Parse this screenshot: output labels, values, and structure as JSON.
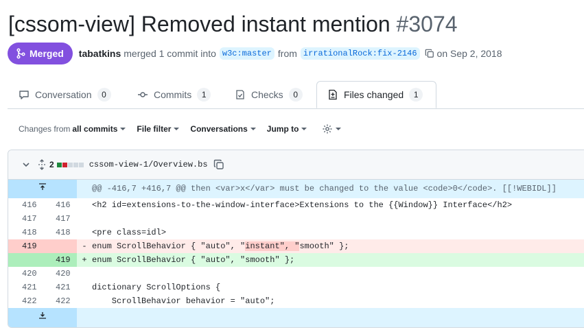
{
  "pr": {
    "title": "[cssom-view] Removed instant mention",
    "number": "#3074",
    "state": "Merged",
    "author": "tabatkins",
    "merged_text": "merged 1 commit into",
    "base_branch": "w3c:master",
    "from_text": "from",
    "head_branch": "irrationalRock:fix-2146",
    "date_text": "on Sep 2, 2018"
  },
  "tabs": [
    {
      "label": "Conversation",
      "count": "0",
      "icon": "comment-icon"
    },
    {
      "label": "Commits",
      "count": "1",
      "icon": "commit-icon"
    },
    {
      "label": "Checks",
      "count": "0",
      "icon": "checklist-icon"
    },
    {
      "label": "Files changed",
      "count": "1",
      "icon": "file-diff-icon"
    }
  ],
  "toolbar": {
    "changes_from_prefix": "Changes from",
    "changes_from_value": "all commits",
    "file_filter": "File filter",
    "conversations": "Conversations",
    "jump_to": "Jump to"
  },
  "file": {
    "change_count": "2",
    "filename": "cssom-view-1/Overview.bs",
    "diffstat": [
      "added",
      "deleted",
      "neutral",
      "neutral",
      "neutral"
    ],
    "colors": {
      "added": "#1f883d",
      "deleted": "#cf222e",
      "neutral": "#d1d9e0"
    }
  },
  "diff": {
    "hunk_header": "@@ -416,7 +416,7 @@ then <var>x</var> must be changed to the value <code>0</code>. [[!WEBIDL]]",
    "lines": [
      {
        "old": "416",
        "new": "416",
        "sign": "",
        "text": "<h2 id=extensions-to-the-window-interface>Extensions to the {{Window}} Interface</h2>"
      },
      {
        "old": "417",
        "new": "417",
        "sign": "",
        "text": ""
      },
      {
        "old": "418",
        "new": "418",
        "sign": "",
        "text": "<pre class=idl>"
      },
      {
        "old": "419",
        "new": "",
        "sign": "-",
        "text_before": "enum ScrollBehavior { \"auto\", \"",
        "text_marked": "instant\", \"",
        "text_after": "smooth\" };"
      },
      {
        "old": "",
        "new": "419",
        "sign": "+",
        "text": "enum ScrollBehavior { \"auto\", \"smooth\" };"
      },
      {
        "old": "420",
        "new": "420",
        "sign": "",
        "text": ""
      },
      {
        "old": "421",
        "new": "421",
        "sign": "",
        "text": "dictionary ScrollOptions {"
      },
      {
        "old": "422",
        "new": "422",
        "sign": "",
        "text": "    ScrollBehavior behavior = \"auto\";"
      }
    ]
  }
}
